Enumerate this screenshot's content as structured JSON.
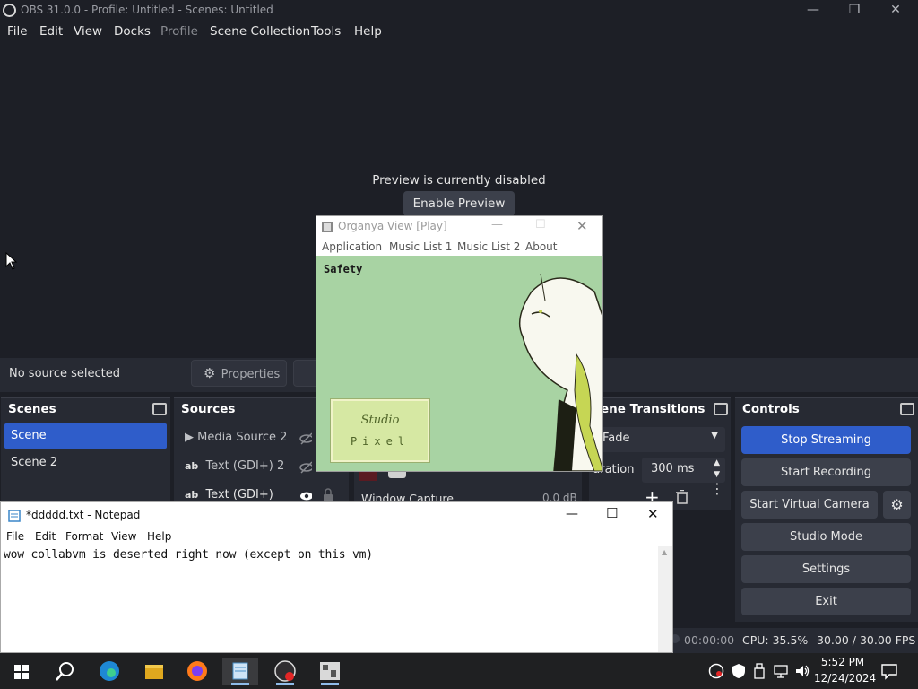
{
  "obs": {
    "title": "OBS 31.0.0 - Profile: Untitled - Scenes: Untitled",
    "menu": [
      "File",
      "Edit",
      "View",
      "Docks",
      "Profile",
      "Scene Collection",
      "Tools",
      "Help"
    ],
    "preview_message": "Preview is currently disabled",
    "enable_preview_label": "Enable Preview",
    "no_source_label": "No source selected",
    "properties_label": "Properties",
    "scenes": {
      "title": "Scenes",
      "items": [
        "Scene",
        "Scene 2"
      ],
      "selected": "Scene"
    },
    "sources": {
      "title": "Sources",
      "items": [
        {
          "label": "Media Source 2",
          "icon": "play-icon",
          "visibility": "hidden"
        },
        {
          "label": "Text (GDI+) 2",
          "icon": "text-icon",
          "visibility": "hidden"
        },
        {
          "label": "Text (GDI+)",
          "icon": "text-icon",
          "visibility": "visible"
        }
      ]
    },
    "mixer": {
      "source_name": "Window Capture",
      "level": "0.0 dB"
    },
    "transitions": {
      "title": "cene Transitions",
      "selected": "Fade",
      "duration_label": "uration",
      "duration_value": "300 ms"
    },
    "controls": {
      "title": "Controls",
      "buttons": [
        "Stop Streaming",
        "Start Recording",
        "Start Virtual Camera",
        "Studio Mode",
        "Settings",
        "Exit"
      ],
      "active": "Stop Streaming"
    },
    "status": {
      "time": "00:00:00",
      "cpu": "CPU: 35.5%",
      "fps": "30.00 / 30.00 FPS"
    }
  },
  "organya": {
    "title": "Organya View [Play]",
    "menu": [
      "Application",
      "Music List 1",
      "Music List 2",
      "About"
    ],
    "song_name": "Safety",
    "logo_line1": "Studio",
    "logo_line2": "Pixel",
    "background_color": "#a8d3a3"
  },
  "notepad": {
    "title": "*ddddd.txt - Notepad",
    "menu": [
      "File",
      "Edit",
      "Format",
      "View",
      "Help"
    ],
    "content": "wow collabvm is deserted right now (except on this vm)"
  },
  "taskbar": {
    "apps": [
      "start-icon",
      "search-icon",
      "edge-icon",
      "file-explorer-icon",
      "firefox-icon",
      "notepad-icon",
      "obs-icon",
      "organya-icon"
    ],
    "time": "5:52 PM",
    "date": "12/24/2024"
  }
}
